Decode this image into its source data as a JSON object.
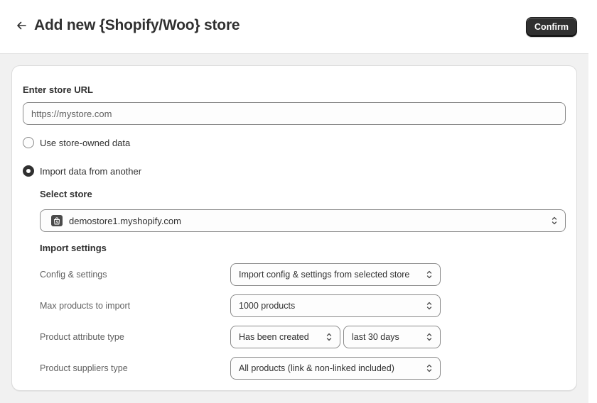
{
  "header": {
    "title": "Add new {Shopify/Woo} store",
    "confirm_label": "Confirm"
  },
  "form": {
    "url_label": "Enter store URL",
    "url_placeholder": "https://mystore.com",
    "url_value": "",
    "radio_options": [
      {
        "label": "Use store-owned data",
        "checked": false
      },
      {
        "label": "Import data from another",
        "checked": true
      }
    ],
    "select_store_label": "Select store",
    "selected_store": "demostore1.myshopify.com",
    "import_settings_title": "Import settings",
    "settings": {
      "config": {
        "label": "Config & settings",
        "value": "Import config & settings from selected store"
      },
      "max_products": {
        "label": "Max products to import",
        "value": "1000 products"
      },
      "attribute_type": {
        "label": "Product attribute type",
        "value": "Has been created",
        "range": "last 30 days"
      },
      "suppliers_type": {
        "label": "Product suppliers type",
        "value": "All products (link & non-linked included)"
      }
    }
  },
  "icons": {
    "back": "arrow-left-icon",
    "store": "shopify-bag-icon",
    "select": "chevron-up-down-icon"
  },
  "colors": {
    "primary_button": "#303030",
    "page_background": "#f1f1f1",
    "card_background": "#ffffff"
  }
}
